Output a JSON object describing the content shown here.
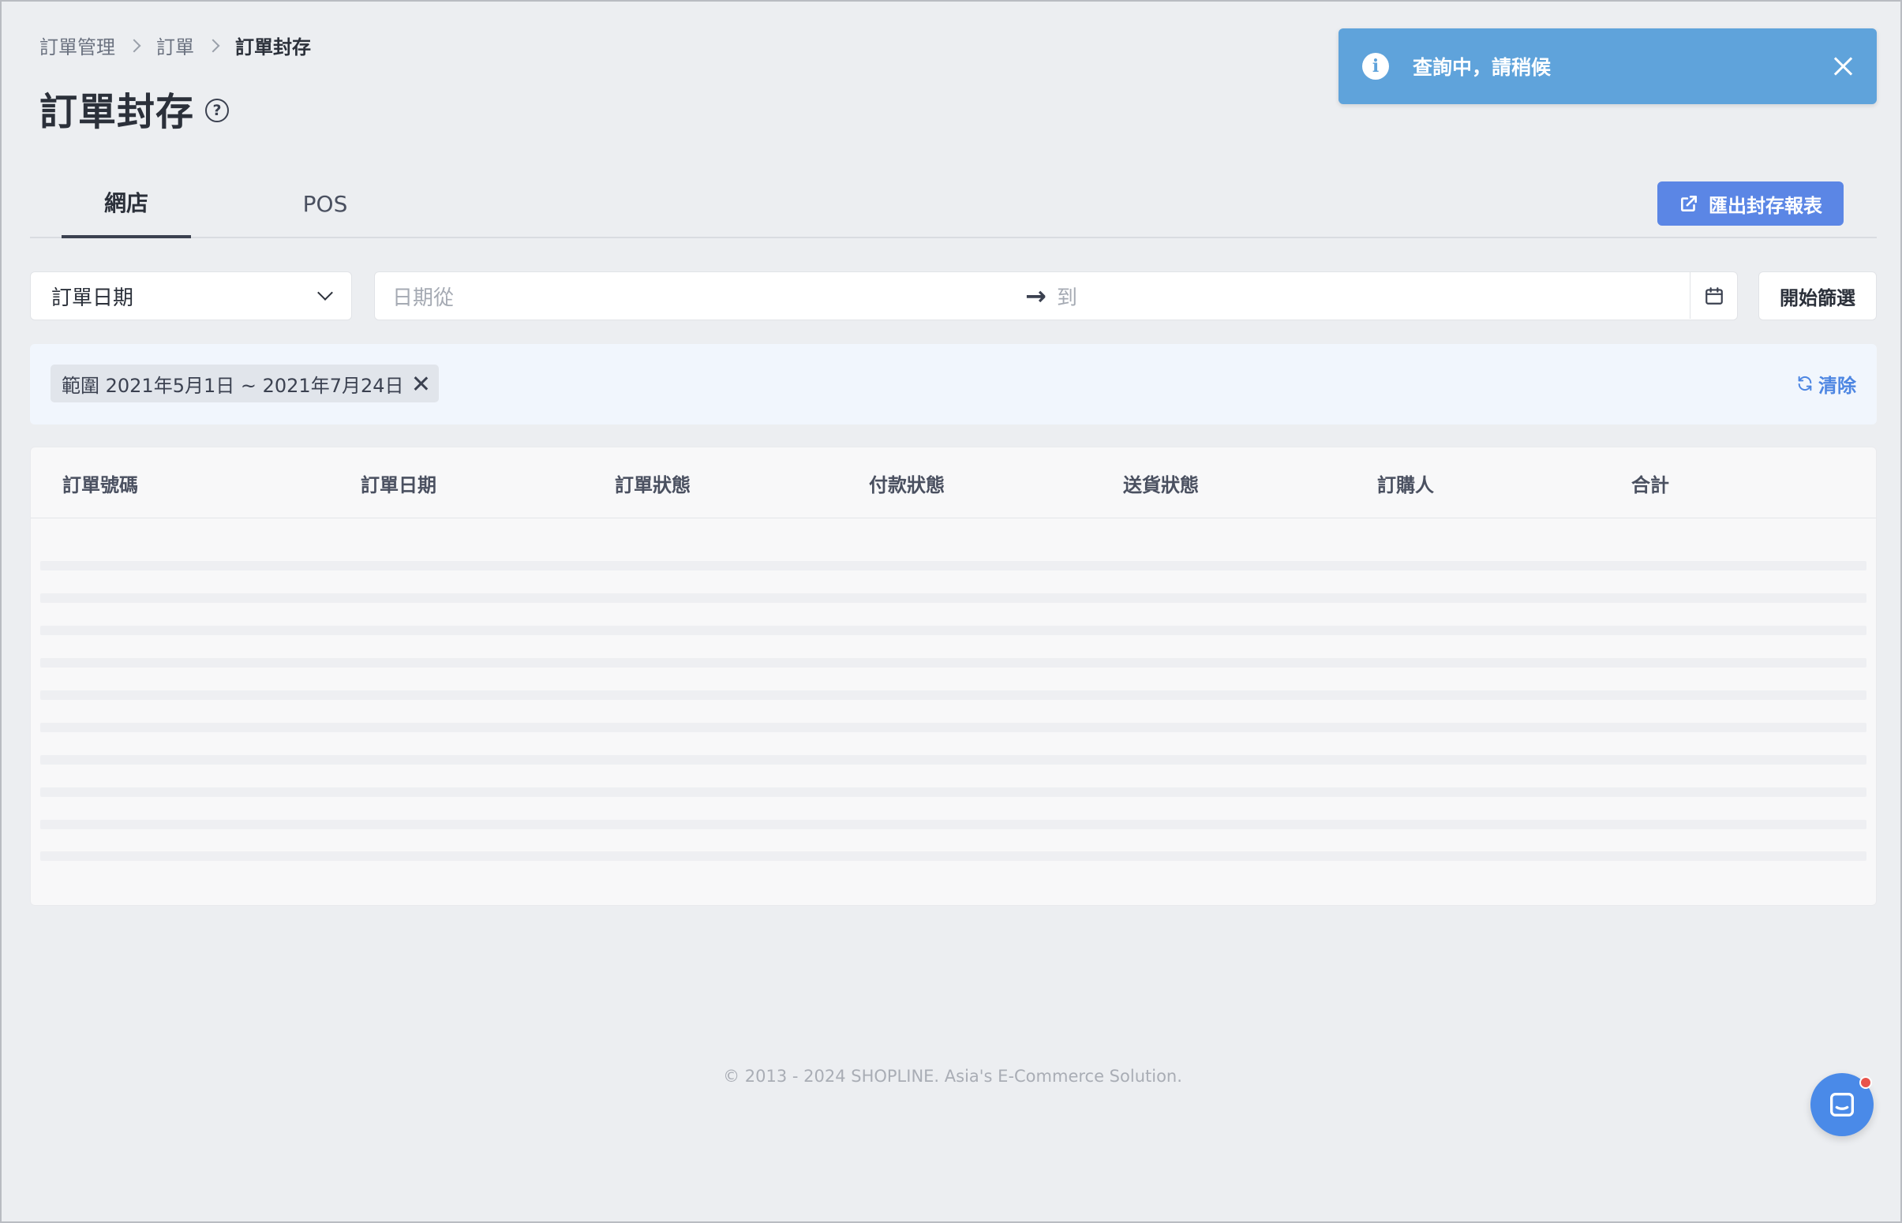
{
  "breadcrumb": {
    "items": [
      "訂單管理",
      "訂單",
      "訂單封存"
    ]
  },
  "page": {
    "title": "訂單封存",
    "help_icon": "question-circle-icon"
  },
  "toast": {
    "message": "查詢中，請稍候",
    "icon": "info-icon",
    "close_icon": "close-icon",
    "color": "#5fa3db"
  },
  "tabs": [
    {
      "label": "網店",
      "active": true
    },
    {
      "label": "POS",
      "active": false
    }
  ],
  "export_button": {
    "label": "匯出封存報表",
    "icon": "external-link-icon",
    "color": "#5b86e5"
  },
  "filters": {
    "date_type": "訂單日期",
    "date_from_placeholder": "日期從",
    "date_to_placeholder": "到",
    "apply_label": "開始篩選"
  },
  "active_filter": {
    "chip_label": "範圍 2021年5月1日 ~ 2021年7月24日",
    "clear_label": "清除"
  },
  "table": {
    "columns": [
      "訂單號碼",
      "訂單日期",
      "訂單狀態",
      "付款狀態",
      "送貨狀態",
      "訂購人",
      "合計"
    ],
    "loading": true
  },
  "footer": {
    "text": "© 2013 - 2024 SHOPLINE. Asia's E-Commerce Solution."
  },
  "chat": {
    "icon": "chat-icon",
    "has_notification": true
  },
  "colors": {
    "accent": "#4d86e2",
    "background": "#eceef1"
  }
}
